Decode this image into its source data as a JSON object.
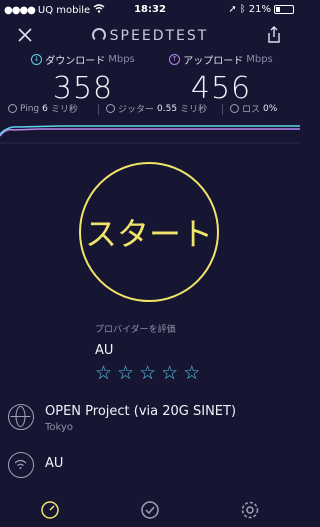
{
  "status_bar": {
    "carrier": "UQ mobile",
    "time": "18:32",
    "battery": "21%",
    "battery_level": 0.21
  },
  "header": {
    "logo": "SPEEDTEST",
    "close_icon": "close-icon",
    "share_icon": "share-icon"
  },
  "download": {
    "label": "ダウンロード",
    "unit": "Mbps",
    "value": "358",
    "color": "#5cd5e8"
  },
  "upload": {
    "label": "アップロード",
    "unit": "Mbps",
    "value": "456",
    "color": "#b685f2"
  },
  "stats": {
    "ping_label": "Ping",
    "ping_value": "6",
    "ping_unit": "ミリ秒",
    "jitter_label": "ジッター",
    "jitter_value": "0.55",
    "jitter_unit": "ミリ秒",
    "loss_label": "ロス",
    "loss_value": "0%"
  },
  "start_button": {
    "label": "スタート",
    "color": "#f0e46a"
  },
  "provider": {
    "rate_label": "プロバイダーを評価",
    "name": "AU",
    "star_count": 5,
    "star_color": "#5cc8e8"
  },
  "server": {
    "name": "OPEN Project (via 20G SINET)",
    "location": "Tokyo"
  },
  "isp": {
    "name": "AU"
  },
  "tabs": [
    {
      "label": "速度",
      "icon": "speed-icon"
    },
    {
      "label": "結果",
      "icon": "results-icon"
    },
    {
      "label": "設定",
      "icon": "settings-icon"
    }
  ],
  "colors": {
    "background": "#161632",
    "accent_yellow": "#f0e46a",
    "download_cyan": "#5cd5e8",
    "upload_purple": "#b685f2"
  }
}
